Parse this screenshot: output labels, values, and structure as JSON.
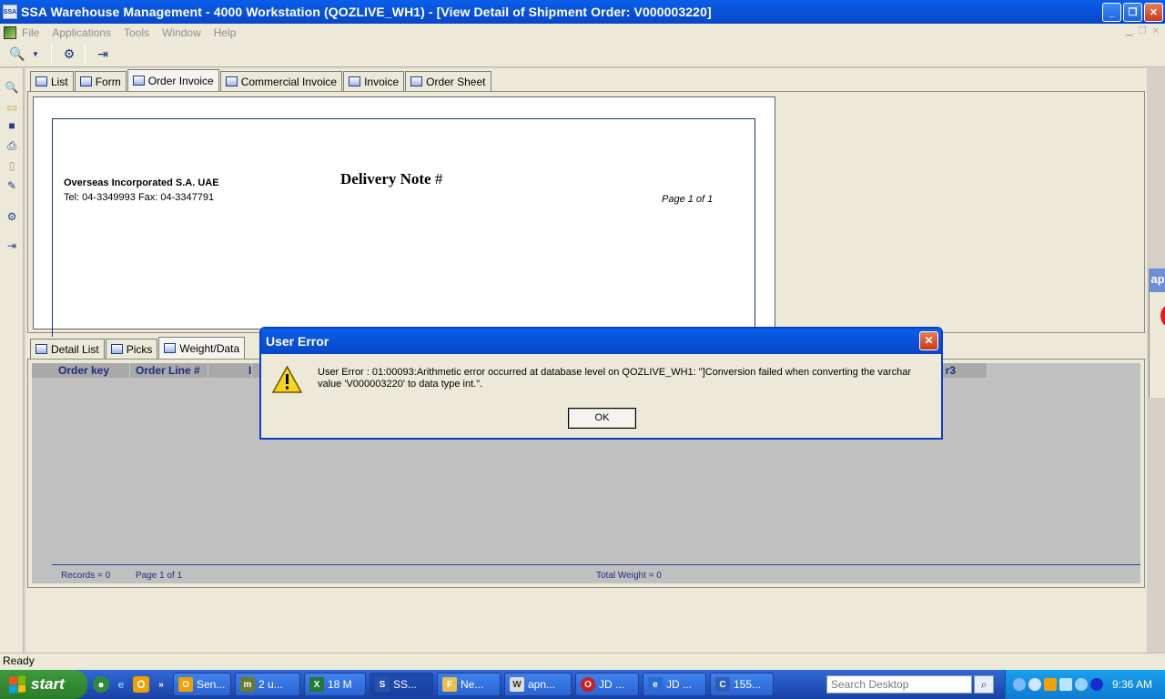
{
  "window": {
    "title": "SSA Warehouse Management - 4000 Workstation (QOZLIVE_WH1) - [View Detail of Shipment Order: V000003220]",
    "logo_text": "SSA"
  },
  "menu": [
    "File",
    "Applications",
    "Tools",
    "Window",
    "Help"
  ],
  "toolbar": {
    "icons": [
      "query-icon",
      "dropdown-icon",
      "print-settings-icon",
      "exit-icon"
    ]
  },
  "left_toolbar": {
    "icons": [
      "query-icon",
      "open-folder-icon",
      "save-icon",
      "print-icon",
      "preview-icon",
      "tool-icon",
      "settings-icon",
      "exit-icon"
    ]
  },
  "top_tabs": [
    {
      "label": "List"
    },
    {
      "label": "Form"
    },
    {
      "label": "Order Invoice"
    },
    {
      "label": "Commercial Invoice"
    },
    {
      "label": "Invoice"
    },
    {
      "label": "Order Sheet"
    }
  ],
  "report": {
    "company": "Overseas Incorporated S.A. UAE",
    "phone": "Tel: 04-3349993 Fax: 04-3347791",
    "title": "Delivery Note",
    "title_hash": "#",
    "page_info": "Page 1 of 1"
  },
  "bottom_tabs": [
    {
      "label": "Detail List"
    },
    {
      "label": "Picks"
    },
    {
      "label": "Weight/Data"
    }
  ],
  "grid": {
    "columns": [
      "Order key",
      "Order Line #",
      "Lo",
      "r3"
    ],
    "records": "Records = 0",
    "page": "Page 1 of 1",
    "total_weight": "Total Weight =  0"
  },
  "status": {
    "text": "Ready"
  },
  "right_fragment": {
    "label": "ap"
  },
  "dialog": {
    "title": "User Error",
    "message": "User Error : 01:00093:Arithmetic error occurred at database level on QOZLIVE_WH1: \"]Conversion failed when converting the varchar value 'V000003220' to data type int.\".",
    "ok_label": "OK"
  },
  "taskbar": {
    "start_label": "start",
    "tasks": [
      {
        "label": "Sen...",
        "icon": "O",
        "color": "#f0a000"
      },
      {
        "label": "2 u...",
        "icon": "m",
        "color": "#6a7b2a"
      },
      {
        "label": "18 M",
        "icon": "X",
        "color": "#1f7a36"
      },
      {
        "label": "SS...",
        "icon": "S",
        "color": "#2750a8"
      },
      {
        "label": "Ne...",
        "icon": "F",
        "color": "#e8c04a"
      },
      {
        "label": "apn...",
        "icon": "W",
        "color": "#dcdcdc"
      },
      {
        "label": "JD ...",
        "icon": "O",
        "color": "#d21c1c"
      },
      {
        "label": "JD ...",
        "icon": "e",
        "color": "#2a6bd1"
      },
      {
        "label": "155...",
        "icon": "C",
        "color": "#2f5fb5"
      }
    ],
    "search_placeholder": "Search Desktop",
    "clock": "9:36 AM"
  }
}
